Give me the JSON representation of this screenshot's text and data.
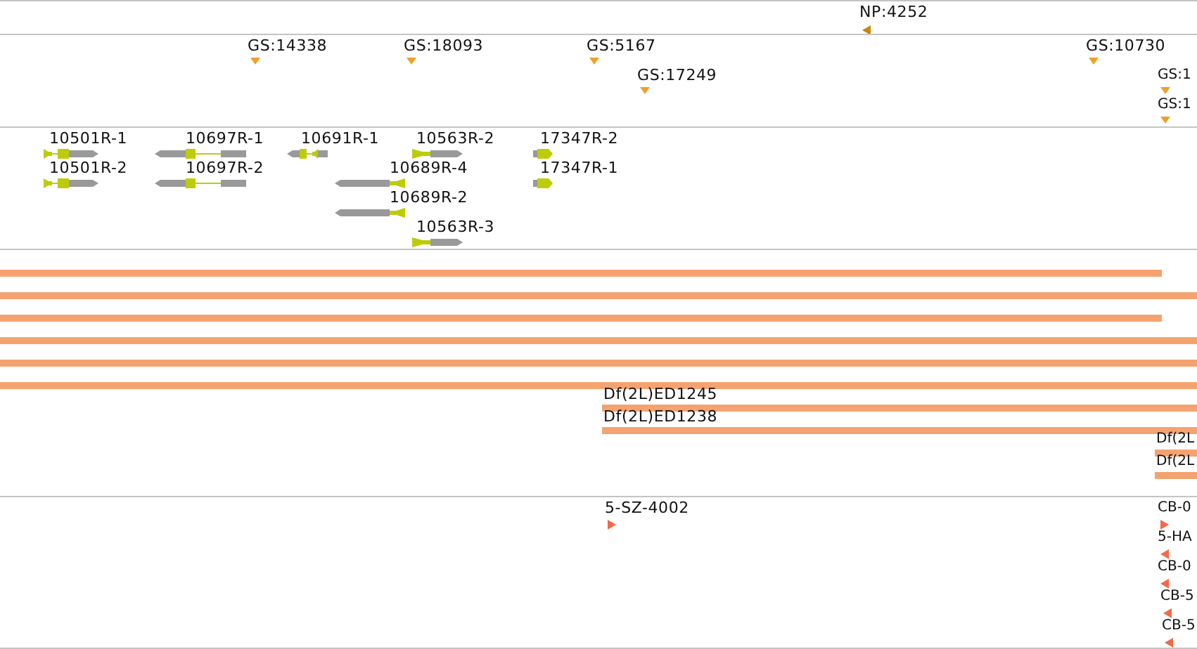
{
  "tracks": [
    {
      "kind": "markers",
      "items": [
        {
          "label": "NP:4252",
          "kind": "left"
        }
      ]
    },
    {
      "kind": "markers",
      "items": [
        {
          "label": "GS:14338",
          "kind": "down"
        },
        {
          "label": "GS:18093",
          "kind": "down"
        },
        {
          "label": "GS:5167",
          "kind": "down"
        },
        {
          "label": "GS:17249",
          "kind": "down"
        },
        {
          "label": "GS:10730",
          "kind": "down"
        },
        {
          "label": "GS:1",
          "kind": "down"
        },
        {
          "label": "GS:1",
          "kind": "down"
        }
      ]
    },
    {
      "kind": "genes",
      "items": [
        {
          "label": "10501R-1"
        },
        {
          "label": "10501R-2"
        },
        {
          "label": "10697R-1"
        },
        {
          "label": "10697R-2"
        },
        {
          "label": "10691R-1"
        },
        {
          "label": "10563R-2"
        },
        {
          "label": "17347R-2"
        },
        {
          "label": "10689R-4"
        },
        {
          "label": "10689R-2"
        },
        {
          "label": "10563R-3"
        },
        {
          "label": "17347R-1"
        }
      ]
    },
    {
      "kind": "bars",
      "items": [
        {
          "kind": "plain"
        },
        {
          "kind": "plain"
        },
        {
          "kind": "plain"
        },
        {
          "kind": "plain"
        },
        {
          "kind": "plain"
        },
        {
          "kind": "plain"
        },
        {
          "kind": "labeled",
          "label": "Df(2L)ED1245"
        },
        {
          "kind": "labeled",
          "label": "Df(2L)ED1238"
        },
        {
          "kind": "labeled",
          "label": "Df(2L"
        },
        {
          "kind": "labeled",
          "label": "Df(2L"
        }
      ]
    },
    {
      "kind": "markers",
      "items": [
        {
          "label": "5-SZ-4002",
          "kind": "right"
        },
        {
          "label": "CB-0",
          "kind": "right"
        },
        {
          "label": "5-HA",
          "kind": "left"
        },
        {
          "label": "CB-0",
          "kind": "left"
        },
        {
          "label": "CB-5",
          "kind": "left"
        },
        {
          "label": "CB-5",
          "kind": "left"
        }
      ]
    }
  ]
}
